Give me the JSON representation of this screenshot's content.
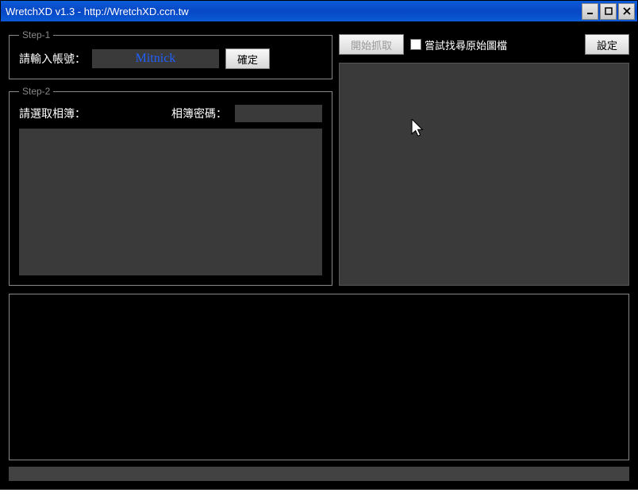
{
  "window": {
    "title": "WretchXD v1.3 - http://WretchXD.ccn.tw"
  },
  "step1": {
    "legend": "Step-1",
    "label": "請輸入帳號：",
    "account_value": "Mitnick",
    "confirm_label": "確定"
  },
  "step2": {
    "legend": "Step-2",
    "select_label": "請選取相簿：",
    "password_label": "相簿密碼：",
    "password_value": ""
  },
  "right": {
    "start_label": "開始抓取",
    "checkbox_label": "嘗試找尋原始圖檔",
    "settings_label": "設定"
  }
}
